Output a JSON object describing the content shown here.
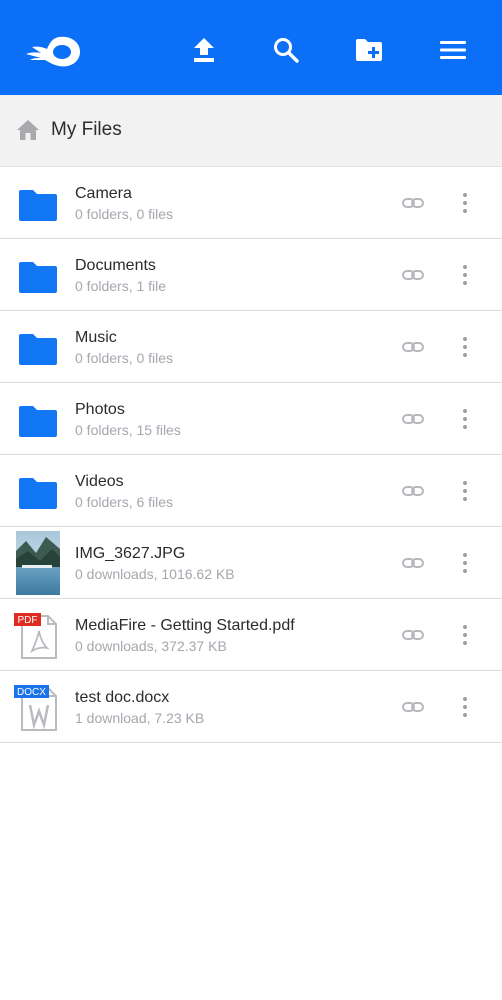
{
  "header": {
    "logo_icon": "mediafire-logo-icon",
    "actions": [
      {
        "icon": "upload-icon"
      },
      {
        "icon": "search-icon"
      },
      {
        "icon": "new-folder-icon"
      },
      {
        "icon": "menu-icon"
      }
    ],
    "brand_color": "#0b6ff7"
  },
  "breadcrumb": {
    "home_icon": "home-icon",
    "current": "My Files"
  },
  "files": [
    {
      "name": "Camera",
      "meta": "0 folders, 0 files",
      "type": "folder"
    },
    {
      "name": "Documents",
      "meta": "0 folders, 1 file",
      "type": "folder"
    },
    {
      "name": "Music",
      "meta": "0 folders, 0 files",
      "type": "folder"
    },
    {
      "name": "Photos",
      "meta": "0 folders, 15 files",
      "type": "folder"
    },
    {
      "name": "Videos",
      "meta": "0 folders, 6 files",
      "type": "folder"
    },
    {
      "name": "IMG_3627.JPG",
      "meta": "0 downloads, 1016.62 KB",
      "type": "image"
    },
    {
      "name": "MediaFire - Getting Started.pdf",
      "meta": "0 downloads, 372.37 KB",
      "type": "pdf",
      "badge": "PDF"
    },
    {
      "name": "test doc.docx",
      "meta": "1 download, 7.23 KB",
      "type": "docx",
      "badge": "DOCX"
    }
  ],
  "colors": {
    "folder": "#1177f5",
    "pdf_badge": "#e02b20",
    "docx_badge": "#1a73e8",
    "secondary_text": "#a6a6ae"
  }
}
